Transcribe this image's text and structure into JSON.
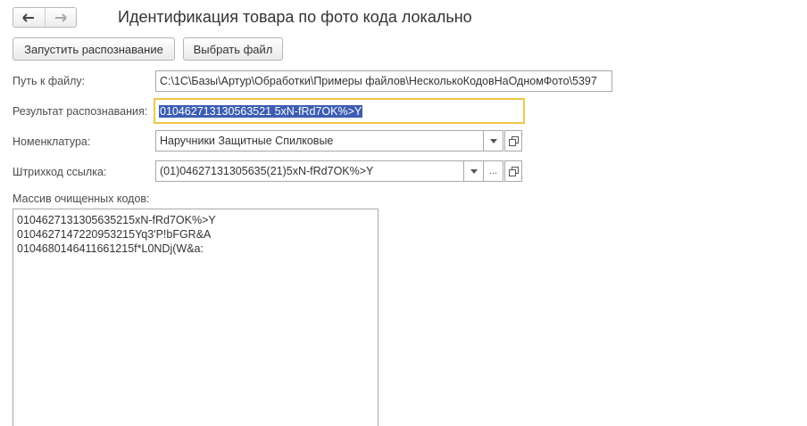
{
  "title": "Идентификация товара по фото кода локально",
  "nav": {
    "back_icon": "arrow-left-icon",
    "forward_icon": "arrow-right-icon"
  },
  "toolbar": {
    "recognize_label": "Запустить распознавание",
    "choose_file_label": "Выбрать файл"
  },
  "form": {
    "file_path_label": "Путь к файлу:",
    "file_path_value": "C:\\1С\\Базы\\Артур\\Обработки\\Примеры файлов\\НесколькоКодовНаОдномФото\\5397",
    "result_label": "Результат распознавания:",
    "result_value": "010462713130563521 5xN-fRd7OK%>Y",
    "nomenclature_label": "Номенклатура:",
    "nomenclature_value": "Наручники Защитные Спилковые",
    "barcode_label": "Штрихкод ссылка:",
    "barcode_value": "(01)04627131305635(21)5xN-fRd7OK%>Y",
    "barcode_more": "...",
    "codes_label": "Массив очищенных кодов:",
    "codes": [
      "0104627131305635215xN-fRd7OK%>Y",
      "0104627147220953215Yq3'P!bFGR&A",
      "0104680146411661215f*L0NDj(W&a:"
    ]
  },
  "colors": {
    "focus_border": "#f0c64a",
    "selection": "#3c5db3"
  }
}
